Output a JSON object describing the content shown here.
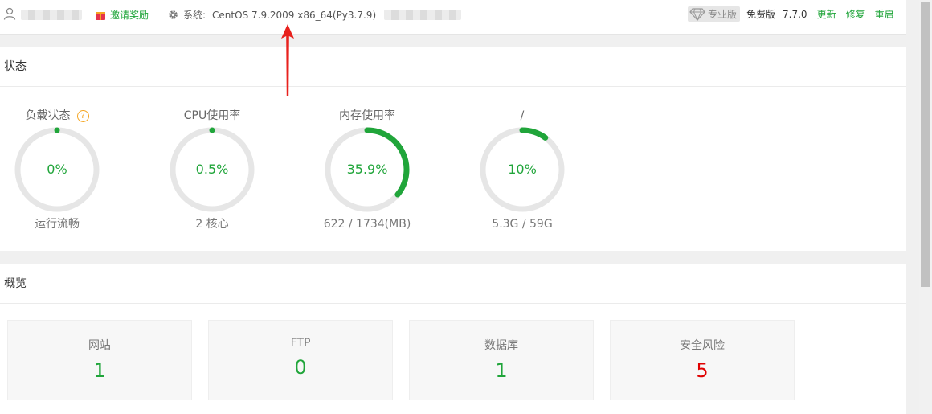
{
  "topbar": {
    "invite_label": "邀请奖励",
    "system_label": "系统:",
    "os_info": "CentOS 7.9.2009 x86_64(Py3.7.9)",
    "pro_tag": "专业版",
    "free_label": "免费版",
    "version": "7.7.0",
    "update_label": "更新",
    "repair_label": "修复",
    "restart_label": "重启"
  },
  "status": {
    "title": "状态",
    "gauges": [
      {
        "title": "负载状态",
        "value": "0%",
        "percent": 0,
        "sub": "运行流畅",
        "help": "?"
      },
      {
        "title": "CPU使用率",
        "value": "0.5%",
        "percent": 0.5,
        "sub": "2 核心"
      },
      {
        "title": "内存使用率",
        "value": "35.9%",
        "percent": 35.9,
        "sub": "622 / 1734(MB)"
      },
      {
        "title": "/",
        "value": "10%",
        "percent": 10,
        "sub": "5.3G / 59G"
      }
    ]
  },
  "overview": {
    "title": "概览",
    "cards": [
      {
        "label": "网站",
        "value": "1"
      },
      {
        "label": "FTP",
        "value": "0"
      },
      {
        "label": "数据库",
        "value": "1"
      },
      {
        "label": "安全风险",
        "value": "5"
      }
    ]
  },
  "colors": {
    "accent": "#20a53a",
    "danger": "#e00000",
    "track": "#e6e6e6",
    "arrow": "#e8211d"
  },
  "icons": {
    "user": "user-icon",
    "gift": "gift-icon",
    "gear": "gear-icon",
    "diamond": "diamond-icon",
    "help": "help-icon",
    "annotation": "arrow-annotation"
  }
}
